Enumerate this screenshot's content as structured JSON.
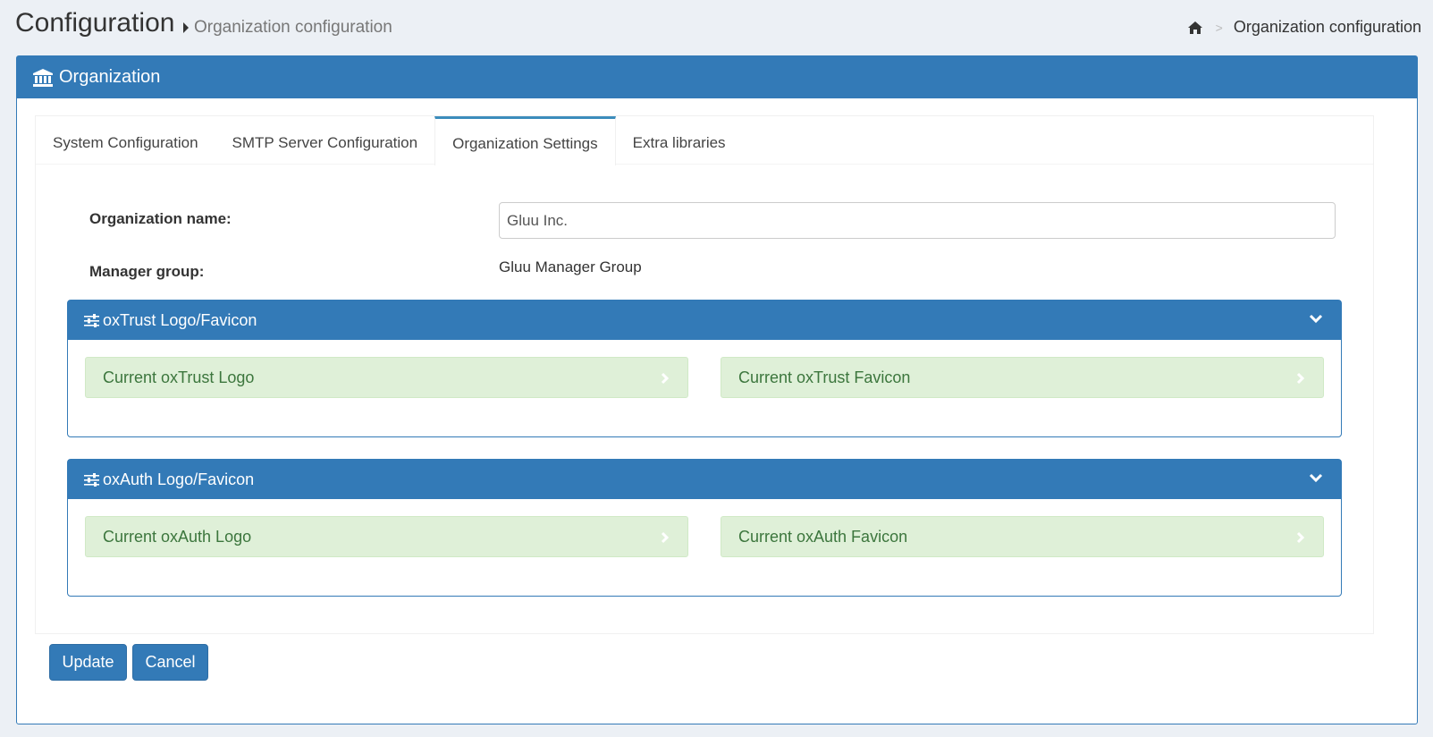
{
  "header": {
    "title": "Configuration",
    "subtitle": "Organization configuration",
    "breadcrumb": {
      "home_icon": "home-icon",
      "separator": ">",
      "current": "Organization configuration"
    }
  },
  "box": {
    "title": "Organization",
    "icon": "bank-icon",
    "accent_color": "#337ab7"
  },
  "tabs": [
    {
      "label": "System Configuration",
      "active": false
    },
    {
      "label": "SMTP Server Configuration",
      "active": false
    },
    {
      "label": "Organization Settings",
      "active": true
    },
    {
      "label": "Extra libraries",
      "active": false
    }
  ],
  "form": {
    "org_name_label": "Organization name:",
    "org_name_value": "Gluu Inc.",
    "manager_group_label": "Manager group:",
    "manager_group_value": "Gluu Manager Group"
  },
  "panels": [
    {
      "title": "oxTrust Logo/Favicon",
      "icon": "sliders-icon",
      "items": [
        {
          "label": "Current oxTrust Logo"
        },
        {
          "label": "Current oxTrust Favicon"
        }
      ]
    },
    {
      "title": "oxAuth Logo/Favicon",
      "icon": "sliders-icon",
      "items": [
        {
          "label": "Current oxAuth Logo"
        },
        {
          "label": "Current oxAuth Favicon"
        }
      ]
    }
  ],
  "actions": {
    "update_label": "Update",
    "cancel_label": "Cancel"
  },
  "colors": {
    "primary": "#337ab7",
    "success_bg": "#dff0d8",
    "success_text": "#3c763d"
  }
}
